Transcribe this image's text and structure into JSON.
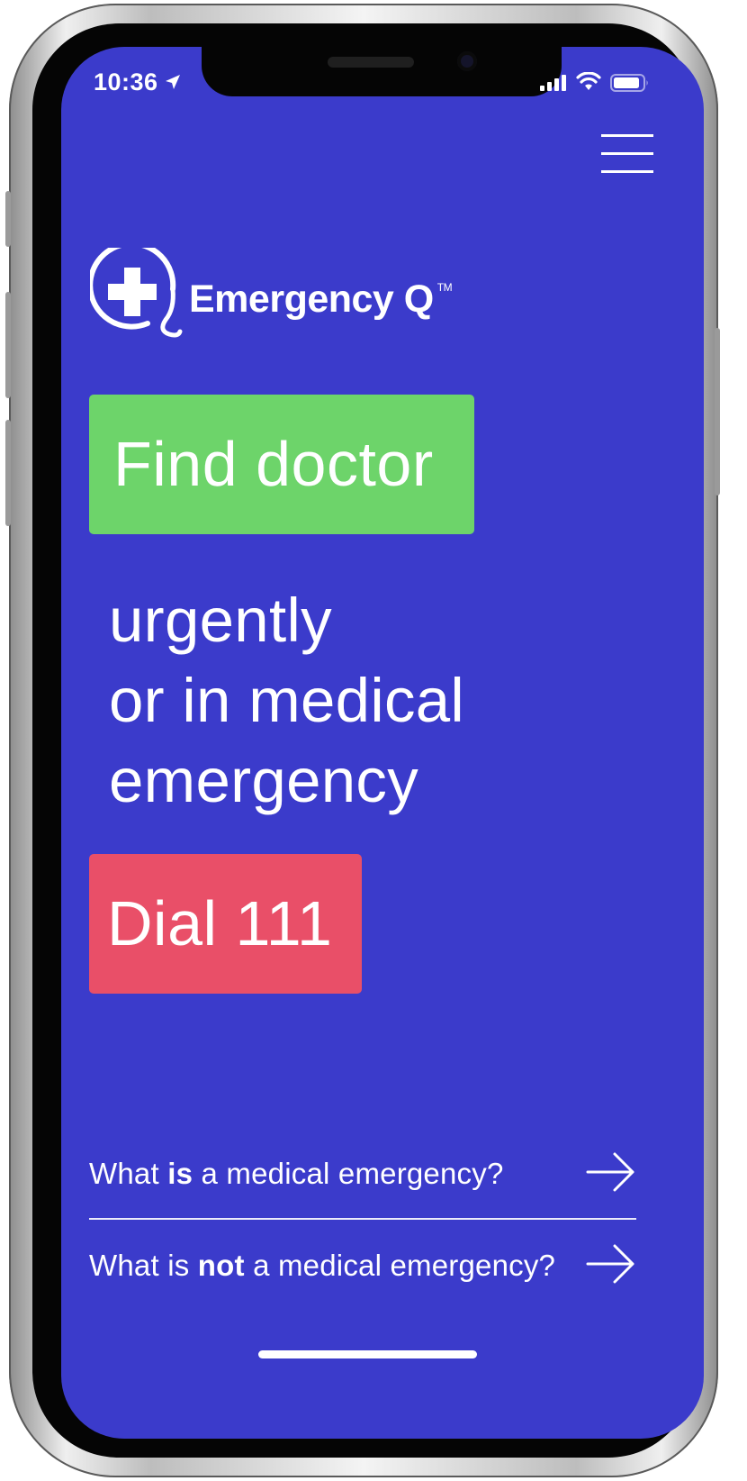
{
  "status_bar": {
    "time": "10:36"
  },
  "brand": {
    "name": "Emergency Q",
    "trademark": "TM"
  },
  "actions": {
    "find_doctor": "Find doctor",
    "dial": "Dial 111"
  },
  "tagline": [
    "urgently",
    "or in medical",
    "emergency"
  ],
  "faq": [
    {
      "before": "What ",
      "bold": "is",
      "after": " a medical emergency?"
    },
    {
      "before": "What is ",
      "bold": "not",
      "after": " a medical emergency?"
    }
  ],
  "colors": {
    "background": "#3b3bcb",
    "find_doctor": "#6dd46a",
    "dial": "#e94f68",
    "text": "#ffffff"
  },
  "icons": [
    "location-arrow-icon",
    "signal-icon",
    "wifi-icon",
    "battery-icon",
    "hamburger-menu-icon",
    "medical-cross-logo-icon",
    "arrow-right-icon"
  ]
}
